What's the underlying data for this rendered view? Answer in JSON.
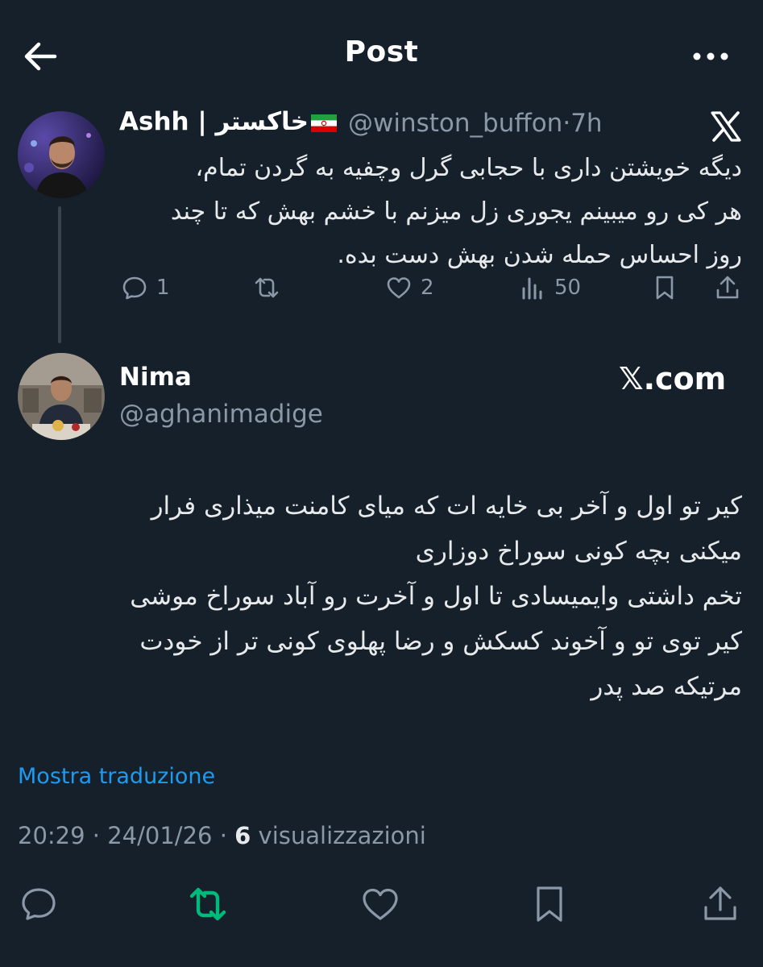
{
  "header": {
    "title": "Post"
  },
  "parent_tweet": {
    "author_name": "Ashh | خاکستر",
    "handle": "@winston_buffon",
    "separator": "·",
    "time": "7h",
    "text_lines": [
      "دیگه خویشتن داری با حجابی گرل وچفیه به گردن تمام،",
      "هر کی رو میبینم یجوری زل میزنم با خشم بهش که تا چند",
      "روز احساس حمله شدن بهش دست بده."
    ],
    "replies": "1",
    "likes": "2",
    "views": "50"
  },
  "quote_tweet": {
    "author_name": "Nima",
    "handle": "@aghanimadige",
    "watermark": "𝕏.com",
    "text_lines": [
      "کیر تو اول و آخر بی خایه ات که میای کامنت میذاری فرار",
      "میکنی بچه کونی سوراخ دوزاری",
      "تخم داشتی وایمیسادی تا اول و آخرت رو آباد سوراخ موشی",
      "کیر توی تو و آخوند کسکش و رضا پهلوی کونی تر از خودت",
      "مرتیکه صد پدر"
    ],
    "translate_label": "Mostra traduzione",
    "time": "20:29",
    "date": "24/01/26",
    "views_count": "6",
    "views_label": "visualizzazioni",
    "dot": "·"
  },
  "colors": {
    "background": "#15202b",
    "muted": "#8b98a5",
    "accent": "#1d9bf0",
    "retweet": "#00ba7c"
  }
}
